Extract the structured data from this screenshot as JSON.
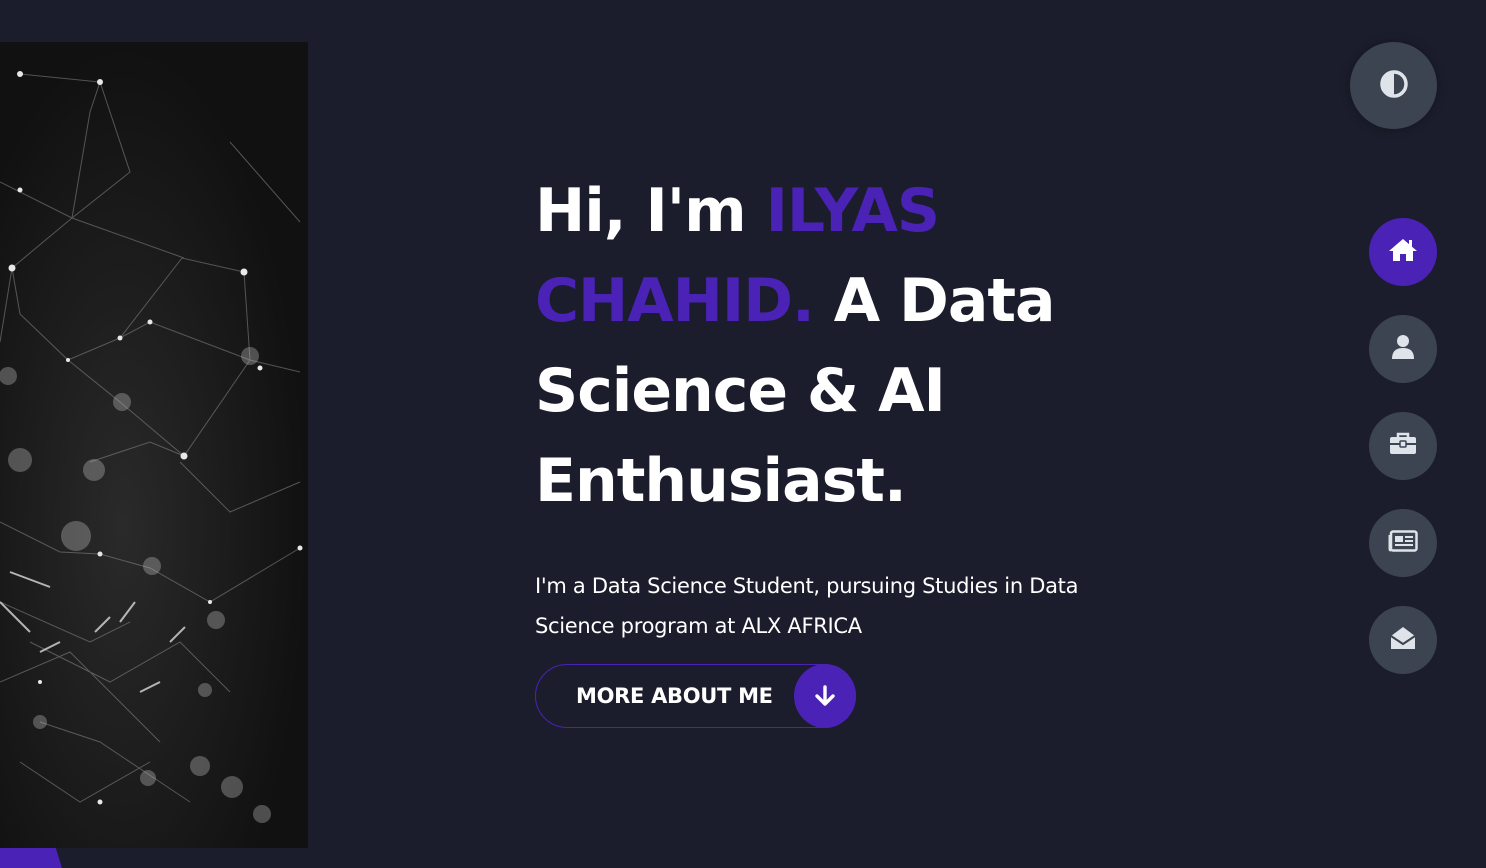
{
  "hero": {
    "greeting": "Hi, I'm ",
    "name_line1": "ILYAS",
    "name_line2": "CHAHID.",
    "title_line2_rest": " A Data",
    "title_line3": "Science & AI",
    "title_line4": "Enthusiast.",
    "intro_line1": "I'm a Data Science Student, pursuing Studies in Data",
    "intro_line2": "Science program at ALX AFRICA",
    "cta_label": "MORE ABOUT ME",
    "cta_icon": "arrow-down-icon"
  },
  "theme_toggle": {
    "icon": "half-circle-contrast-icon"
  },
  "nav": {
    "items": [
      {
        "icon": "home-icon",
        "active": true
      },
      {
        "icon": "user-icon",
        "active": false
      },
      {
        "icon": "briefcase-icon",
        "active": false
      },
      {
        "icon": "newspaper-icon",
        "active": false
      },
      {
        "icon": "envelope-open-icon",
        "active": false
      }
    ]
  },
  "colors": {
    "background": "#1b1d2c",
    "accent": "#4a22b5",
    "button_gray": "#3d4451",
    "text": "#ffffff"
  }
}
